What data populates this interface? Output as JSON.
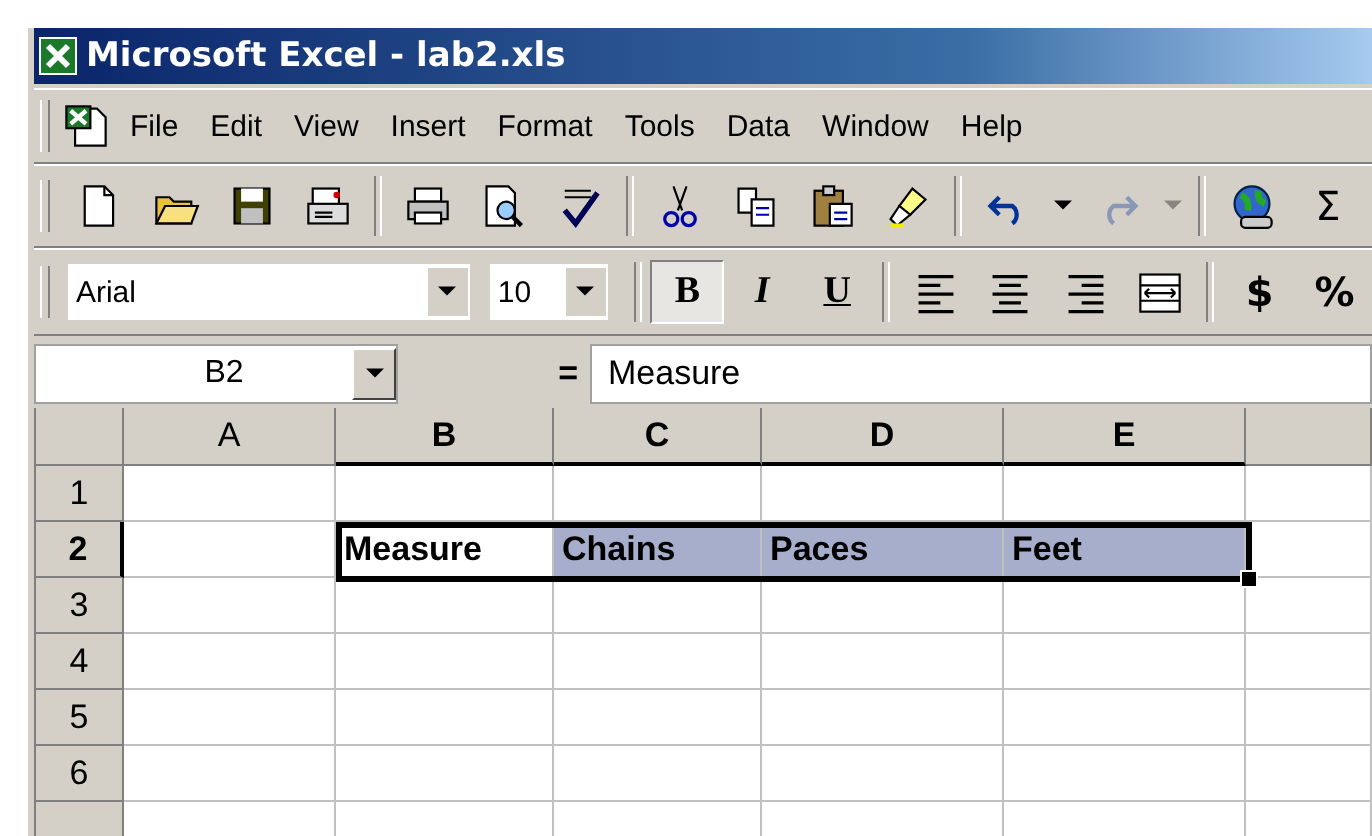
{
  "window": {
    "title": "Microsoft Excel - lab2.xls"
  },
  "menu": [
    {
      "label": "File"
    },
    {
      "label": "Edit"
    },
    {
      "label": "View"
    },
    {
      "label": "Insert"
    },
    {
      "label": "Format"
    },
    {
      "label": "Tools"
    },
    {
      "label": "Data"
    },
    {
      "label": "Window"
    },
    {
      "label": "Help"
    }
  ],
  "standard_toolbar": {
    "redo": {
      "disabled": true
    },
    "autosum": "Σ"
  },
  "formatting_toolbar": {
    "font": "Arial",
    "size": "10",
    "styles": [
      {
        "label": "B",
        "kind": "bold",
        "pressed": true
      },
      {
        "label": "I",
        "kind": "italic",
        "pressed": false
      },
      {
        "label": "U",
        "kind": "underline",
        "pressed": false
      }
    ],
    "number_buttons": [
      "$",
      "%"
    ]
  },
  "formula_bar": {
    "name_box": "B2",
    "equals": "=",
    "value": "Measure"
  },
  "sheet": {
    "columns": [
      {
        "label": "A",
        "selected": false
      },
      {
        "label": "B",
        "selected": true
      },
      {
        "label": "C",
        "selected": true
      },
      {
        "label": "D",
        "selected": true
      },
      {
        "label": "E",
        "selected": true
      }
    ],
    "rows": [
      {
        "label": "1",
        "selected": false
      },
      {
        "label": "2",
        "selected": true,
        "cells": [
          {
            "highlighted": false
          },
          {
            "text": "Measure",
            "highlighted": false
          },
          {
            "text": "Chains",
            "highlighted": true
          },
          {
            "text": "Paces",
            "highlighted": true
          },
          {
            "text": "Feet",
            "highlighted": true
          }
        ]
      },
      {
        "label": "3",
        "selected": false
      },
      {
        "label": "4",
        "selected": false
      },
      {
        "label": "5",
        "selected": false
      },
      {
        "label": "6",
        "selected": false
      }
    ]
  }
}
